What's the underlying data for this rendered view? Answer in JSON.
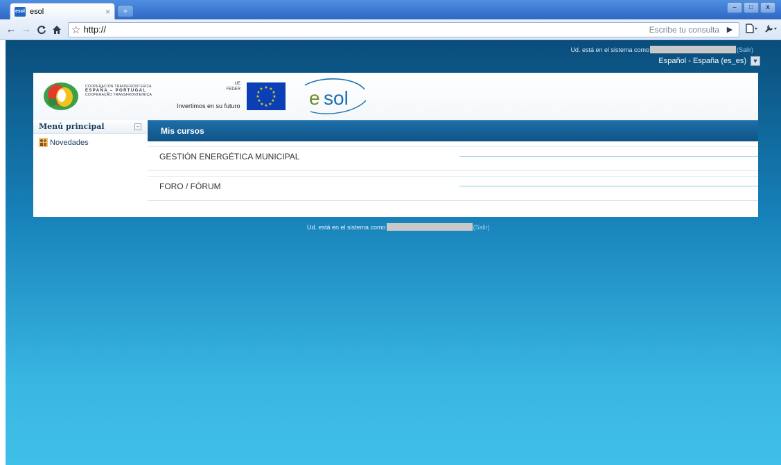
{
  "browser": {
    "tab_title": "esol",
    "tab_close": "×",
    "new_tab": "+",
    "url": "http://",
    "search_placeholder": "Escribe tu consulta",
    "window_buttons": [
      "–",
      "□",
      "x"
    ]
  },
  "header": {
    "login_text": "Ud. está en el sistema como",
    "logout_link": "(Salir)",
    "language": "Español - España (es_es)"
  },
  "banner": {
    "coop_lines": [
      "COOPERACIÓN TRANSFRONTERIZA",
      "ESPAÑA – PORTUGAL",
      "COOPERAÇÃO TRANSFRONTEIRIÇA"
    ],
    "ue_line": "UE",
    "feder_line": "FEDER",
    "slogan": "Invertimos en su futuro",
    "brand": "esol"
  },
  "sidebar": {
    "title": "Menú principal",
    "items": [
      {
        "label": "Novedades"
      }
    ]
  },
  "courses": {
    "title": "Mis cursos",
    "items": [
      {
        "name": "GESTIÓN ENERGÉTICA MUNICIPAL"
      },
      {
        "name": "FORO / FÓRUM"
      }
    ]
  },
  "footer": {
    "login_text": "Ud. está en el sistema como",
    "logout_link": "(Salir)"
  },
  "colors": {
    "page_top": "#0a4d7b",
    "page_bottom": "#3fc0e8",
    "courses_header": "#1e6ea8",
    "sidebar_text": "#1a3d5e"
  }
}
